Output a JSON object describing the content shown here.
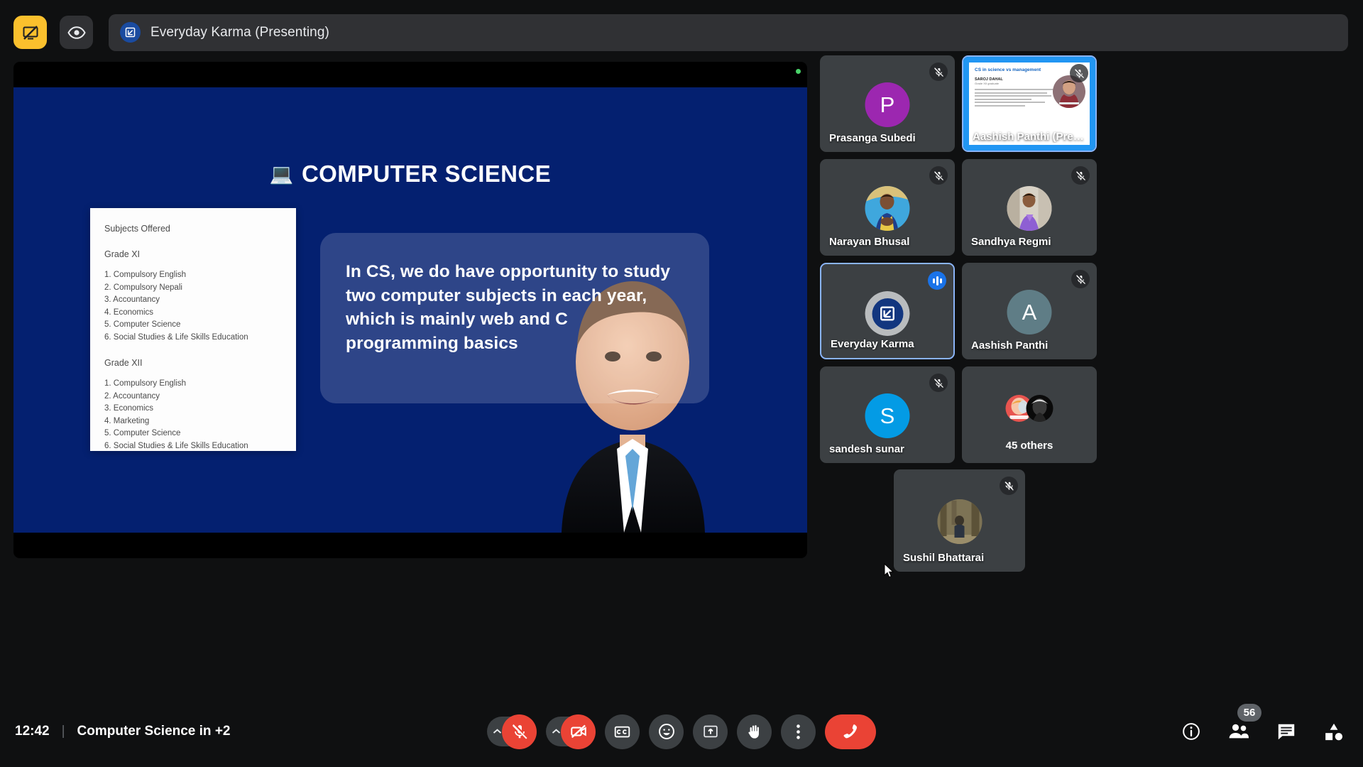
{
  "topbar": {
    "screenshare_stop_icon": "screen-share-off-icon",
    "visibility_icon": "eye-icon",
    "presenter_initial_icon": "everyday-karma-logo-icon",
    "presenting_title": "Everyday Karma (Presenting)"
  },
  "slide": {
    "title": "COMPUTER SCIENCE",
    "title_emoji": "💻",
    "background_color": "#042070",
    "subjects_card": {
      "heading": "Subjects Offered",
      "grade_xi_label": "Grade XI",
      "grade_xi": [
        "1. Compulsory English",
        "2. Compulsory Nepali",
        "3. Accountancy",
        "4. Economics",
        "5. Computer Science",
        "6. Social Studies & Life Skills Education"
      ],
      "grade_xii_label": "Grade XII",
      "grade_xii": [
        "1. Compulsory English",
        "2. Accountancy",
        "3. Economics",
        "4. Marketing",
        "5. Computer Science",
        "6. Social Studies & Life Skills Education"
      ]
    },
    "callout_text": "In CS, we do have opportunity to study two computer subjects in each year, which is mainly  web and C programming basics"
  },
  "participants": {
    "rows": [
      [
        {
          "name": "Prasanga Subedi",
          "initial": "P",
          "avatar_color": "#9c27b0",
          "type": "initial",
          "muted": true
        },
        {
          "name": "Aashish Panthi (Prese...",
          "type": "presenting-thumb",
          "muted": true,
          "thumb": {
            "title": "CS in science vs management",
            "presenter": "SAROJ DAHAL",
            "subtitle": "Grade XII graduate"
          }
        }
      ],
      [
        {
          "name": "Narayan Bhusal",
          "type": "photo",
          "avatar_color": "#4a90c2",
          "muted": true
        },
        {
          "name": "Sandhya Regmi",
          "type": "photo",
          "avatar_color": "#b9a79a",
          "muted": true
        }
      ],
      [
        {
          "name": "Everyday Karma",
          "type": "logo",
          "avatar_color": "#1a3a8f",
          "speaking": true,
          "muted": false
        },
        {
          "name": "Aashish Panthi",
          "initial": "A",
          "avatar_color": "#5f7d86",
          "type": "initial",
          "muted": true
        }
      ],
      [
        {
          "name": "sandesh sunar",
          "initial": "S",
          "avatar_color": "#039be5",
          "type": "initial",
          "muted": true
        },
        {
          "name": "45 others",
          "type": "others",
          "muted": false
        }
      ]
    ],
    "floating": {
      "name": "Sushil Bhattarai",
      "type": "photo",
      "avatar_color": "#6b6248",
      "muted": true
    }
  },
  "bottombar": {
    "time": "12:42",
    "separator": "|",
    "meeting_name": "Computer Science in +2",
    "controls": [
      {
        "name": "microphone-options-caret",
        "icon": "chevron-up-icon"
      },
      {
        "name": "microphone-button",
        "icon": "mic-off-icon",
        "state": "muted",
        "color": "#ea4335"
      },
      {
        "name": "camera-options-caret",
        "icon": "chevron-up-icon"
      },
      {
        "name": "camera-button",
        "icon": "video-off-icon",
        "state": "off",
        "color": "#ea4335"
      },
      {
        "name": "captions-button",
        "icon": "closed-captions-icon"
      },
      {
        "name": "reactions-button",
        "icon": "emoji-smiley-icon"
      },
      {
        "name": "present-button",
        "icon": "present-screen-icon"
      },
      {
        "name": "raise-hand-button",
        "icon": "raised-hand-icon"
      },
      {
        "name": "more-options-button",
        "icon": "more-vertical-icon"
      },
      {
        "name": "leave-call-button",
        "icon": "phone-hangup-icon",
        "color": "#ea4335"
      }
    ],
    "right_controls": [
      {
        "name": "meeting-details-button",
        "icon": "info-circle-icon"
      },
      {
        "name": "people-button",
        "icon": "people-icon",
        "badge": "56"
      },
      {
        "name": "chat-button",
        "icon": "chat-bubble-icon"
      },
      {
        "name": "activities-button",
        "icon": "shapes-activities-icon"
      }
    ]
  },
  "colors": {
    "accent_blue": "#8ab4f8",
    "red": "#ea4335",
    "yellow": "#fbc02d",
    "slide_blue": "#042070"
  }
}
